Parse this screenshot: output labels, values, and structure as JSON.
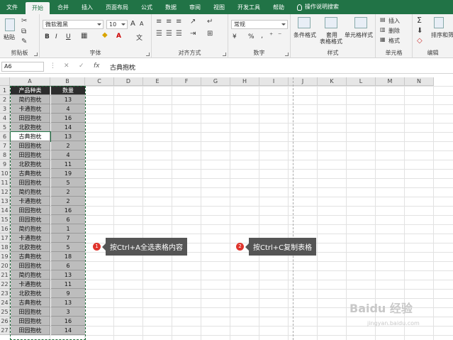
{
  "tabs": [
    "文件",
    "开始",
    "合并",
    "插入",
    "页面布局",
    "公式",
    "数据",
    "审阅",
    "视图",
    "开发工具",
    "帮助"
  ],
  "tell_me": "操作说明搜索",
  "ribbon": {
    "clipboard": {
      "label": "剪贴板",
      "paste": "粘贴"
    },
    "font": {
      "label": "字体",
      "font_name": "微软雅黑",
      "font_size": "10",
      "bold": "B",
      "italic": "I",
      "underline": "U",
      "grow": "A",
      "shrink": "A",
      "color_a": "A",
      "wen": "文"
    },
    "align": {
      "label": "对齐方式"
    },
    "number": {
      "label": "数字",
      "format": "常规",
      "currency": "¥",
      "percent": "%"
    },
    "styles": {
      "label": "样式",
      "cond": "条件格式",
      "table1": "套用",
      "table2": "表格格式",
      "cell": "单元格样式"
    },
    "cells": {
      "label": "单元格",
      "insert": "插入",
      "delete": "删除",
      "format": "格式"
    },
    "edit": {
      "label": "编辑",
      "sum": "Σ",
      "sort": "排序和筛"
    }
  },
  "formula_bar": {
    "name_box": "A6",
    "fx": "fx",
    "content": "古典抱枕"
  },
  "columns": [
    "A",
    "B",
    "C",
    "D",
    "E",
    "F",
    "G",
    "H",
    "I",
    "J",
    "K",
    "L",
    "M",
    "N"
  ],
  "rows": [
    "1",
    "2",
    "3",
    "4",
    "5",
    "6",
    "7",
    "8",
    "9",
    "10",
    "11",
    "12",
    "13",
    "14",
    "15",
    "16",
    "17",
    "18",
    "19",
    "20",
    "21",
    "22",
    "23",
    "24",
    "25",
    "26",
    "27"
  ],
  "table": {
    "headers": [
      "产品种类",
      "数量"
    ],
    "data": [
      [
        "简约抱枕",
        "13"
      ],
      [
        "卡通抱枕",
        "4"
      ],
      [
        "田园抱枕",
        "16"
      ],
      [
        "北欧抱枕",
        "14"
      ],
      [
        "古典抱枕",
        "13"
      ],
      [
        "田园抱枕",
        "2"
      ],
      [
        "田园抱枕",
        "4"
      ],
      [
        "北欧抱枕",
        "11"
      ],
      [
        "古典抱枕",
        "19"
      ],
      [
        "田园抱枕",
        "5"
      ],
      [
        "简约抱枕",
        "2"
      ],
      [
        "卡通抱枕",
        "2"
      ],
      [
        "田园抱枕",
        "16"
      ],
      [
        "田园抱枕",
        "6"
      ],
      [
        "简约抱枕",
        "1"
      ],
      [
        "卡通抱枕",
        "7"
      ],
      [
        "北欧抱枕",
        "5"
      ],
      [
        "古典抱枕",
        "18"
      ],
      [
        "田园抱枕",
        "6"
      ],
      [
        "简约抱枕",
        "13"
      ],
      [
        "卡通抱枕",
        "11"
      ],
      [
        "北欧抱枕",
        "9"
      ],
      [
        "古典抱枕",
        "13"
      ],
      [
        "田园抱枕",
        "3"
      ],
      [
        "田园抱枕",
        "16"
      ],
      [
        "田园抱枕",
        "14"
      ]
    ]
  },
  "callouts": [
    {
      "num": "1",
      "text": "按Ctrl+A全选表格内容"
    },
    {
      "num": "2",
      "text": "按Ctrl+C复制表格"
    }
  ],
  "watermark": {
    "text": "Baidu 经验",
    "sub": "jingyan.baidu.com"
  }
}
